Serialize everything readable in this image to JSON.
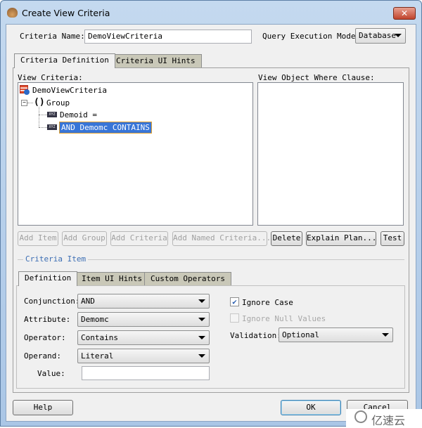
{
  "window": {
    "title": "Create View Criteria"
  },
  "criteria_name": {
    "label": "Criteria Name:",
    "value": "DemoViewCriteria"
  },
  "query_mode": {
    "label": "Query Execution Mode:",
    "value": "Database"
  },
  "tabs": [
    {
      "label": "Criteria Definition",
      "active": true
    },
    {
      "label": "Criteria UI Hints",
      "active": false
    }
  ],
  "view_criteria": {
    "label": "View Criteria:",
    "tree": {
      "root": "DemoViewCriteria",
      "group": "Group",
      "items": [
        "Demoid =",
        "AND Demomc CONTAINS"
      ],
      "selected": "AND Demomc CONTAINS"
    }
  },
  "where_clause": {
    "label": "View Object Where Clause:"
  },
  "actions": {
    "add_item": "Add Item",
    "add_group": "Add Group",
    "add_criteria": "Add Criteria",
    "add_named": "Add Named Criteria...",
    "delete": "Delete",
    "explain": "Explain Plan...",
    "test": "Test"
  },
  "criteria_item": {
    "title": "Criteria Item",
    "tabs": [
      {
        "label": "Definition",
        "active": true
      },
      {
        "label": "Item UI Hints",
        "active": false
      },
      {
        "label": "Custom Operators",
        "active": false
      }
    ],
    "conjunction": {
      "label": "Conjunction:",
      "value": "AND"
    },
    "attribute": {
      "label": "Attribute:",
      "value": "Demomc"
    },
    "operator": {
      "label": "Operator:",
      "value": "Contains"
    },
    "operand": {
      "label": "Operand:",
      "value": "Literal"
    },
    "value": {
      "label": "Value:",
      "value": ""
    },
    "ignore_case": {
      "label": "Ignore Case",
      "checked": true
    },
    "ignore_null": {
      "label": "Ignore Null Values",
      "checked": false,
      "disabled": true
    },
    "validation": {
      "label": "Validation:",
      "value": "Optional"
    }
  },
  "footer": {
    "help": "Help",
    "ok": "OK",
    "cancel": "Cancel"
  },
  "watermark": "亿速云",
  "colors": {
    "selection": "#3875d7",
    "group_title": "#3c6eb4"
  }
}
